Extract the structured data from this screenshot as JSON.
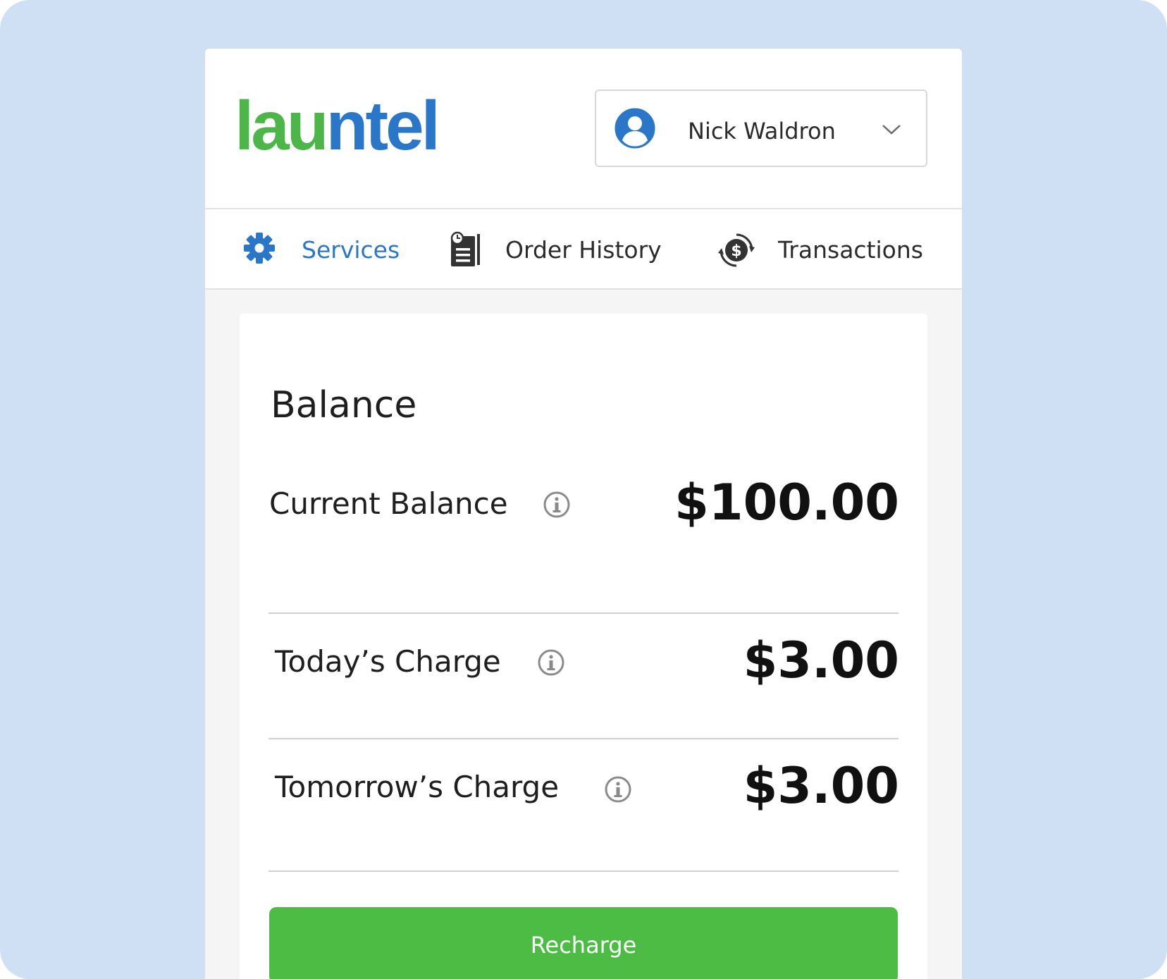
{
  "brand": {
    "logo_part1": "lau",
    "logo_part2": "ntel",
    "green": "#4cb648",
    "blue": "#2a76c9"
  },
  "user_menu": {
    "name": "Nick Waldron",
    "avatar_icon": "user-circle-icon",
    "dropdown_icon": "chevron-down-icon"
  },
  "nav": {
    "tabs": [
      {
        "label": "Services",
        "icon": "gear-icon",
        "active": true
      },
      {
        "label": "Order History",
        "icon": "document-clock-icon",
        "active": false
      },
      {
        "label": "Transactions",
        "icon": "dollar-cycle-icon",
        "active": false
      }
    ]
  },
  "balance": {
    "title": "Balance",
    "rows": [
      {
        "label": "Current Balance",
        "amount": "$100.00",
        "icon": "info-icon"
      },
      {
        "label": "Today’s Charge",
        "amount": "$3.00",
        "icon": "info-icon"
      },
      {
        "label": "Tomorrow’s Charge",
        "amount": "$3.00",
        "icon": "info-icon"
      }
    ],
    "recharge_label": "Recharge",
    "button_color": "#4cbc45"
  }
}
